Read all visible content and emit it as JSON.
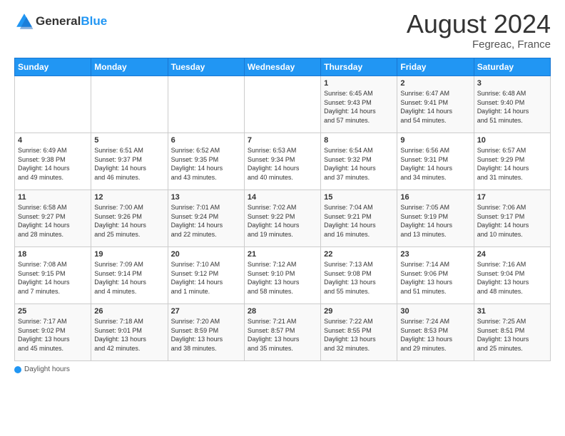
{
  "header": {
    "logo": {
      "general": "General",
      "blue": "Blue"
    },
    "month_year": "August 2024",
    "location": "Fegreac, France"
  },
  "days_of_week": [
    "Sunday",
    "Monday",
    "Tuesday",
    "Wednesday",
    "Thursday",
    "Friday",
    "Saturday"
  ],
  "weeks": [
    [
      {
        "day": "",
        "info": ""
      },
      {
        "day": "",
        "info": ""
      },
      {
        "day": "",
        "info": ""
      },
      {
        "day": "",
        "info": ""
      },
      {
        "day": "1",
        "info": "Sunrise: 6:45 AM\nSunset: 9:43 PM\nDaylight: 14 hours\nand 57 minutes."
      },
      {
        "day": "2",
        "info": "Sunrise: 6:47 AM\nSunset: 9:41 PM\nDaylight: 14 hours\nand 54 minutes."
      },
      {
        "day": "3",
        "info": "Sunrise: 6:48 AM\nSunset: 9:40 PM\nDaylight: 14 hours\nand 51 minutes."
      }
    ],
    [
      {
        "day": "4",
        "info": "Sunrise: 6:49 AM\nSunset: 9:38 PM\nDaylight: 14 hours\nand 49 minutes."
      },
      {
        "day": "5",
        "info": "Sunrise: 6:51 AM\nSunset: 9:37 PM\nDaylight: 14 hours\nand 46 minutes."
      },
      {
        "day": "6",
        "info": "Sunrise: 6:52 AM\nSunset: 9:35 PM\nDaylight: 14 hours\nand 43 minutes."
      },
      {
        "day": "7",
        "info": "Sunrise: 6:53 AM\nSunset: 9:34 PM\nDaylight: 14 hours\nand 40 minutes."
      },
      {
        "day": "8",
        "info": "Sunrise: 6:54 AM\nSunset: 9:32 PM\nDaylight: 14 hours\nand 37 minutes."
      },
      {
        "day": "9",
        "info": "Sunrise: 6:56 AM\nSunset: 9:31 PM\nDaylight: 14 hours\nand 34 minutes."
      },
      {
        "day": "10",
        "info": "Sunrise: 6:57 AM\nSunset: 9:29 PM\nDaylight: 14 hours\nand 31 minutes."
      }
    ],
    [
      {
        "day": "11",
        "info": "Sunrise: 6:58 AM\nSunset: 9:27 PM\nDaylight: 14 hours\nand 28 minutes."
      },
      {
        "day": "12",
        "info": "Sunrise: 7:00 AM\nSunset: 9:26 PM\nDaylight: 14 hours\nand 25 minutes."
      },
      {
        "day": "13",
        "info": "Sunrise: 7:01 AM\nSunset: 9:24 PM\nDaylight: 14 hours\nand 22 minutes."
      },
      {
        "day": "14",
        "info": "Sunrise: 7:02 AM\nSunset: 9:22 PM\nDaylight: 14 hours\nand 19 minutes."
      },
      {
        "day": "15",
        "info": "Sunrise: 7:04 AM\nSunset: 9:21 PM\nDaylight: 14 hours\nand 16 minutes."
      },
      {
        "day": "16",
        "info": "Sunrise: 7:05 AM\nSunset: 9:19 PM\nDaylight: 14 hours\nand 13 minutes."
      },
      {
        "day": "17",
        "info": "Sunrise: 7:06 AM\nSunset: 9:17 PM\nDaylight: 14 hours\nand 10 minutes."
      }
    ],
    [
      {
        "day": "18",
        "info": "Sunrise: 7:08 AM\nSunset: 9:15 PM\nDaylight: 14 hours\nand 7 minutes."
      },
      {
        "day": "19",
        "info": "Sunrise: 7:09 AM\nSunset: 9:14 PM\nDaylight: 14 hours\nand 4 minutes."
      },
      {
        "day": "20",
        "info": "Sunrise: 7:10 AM\nSunset: 9:12 PM\nDaylight: 14 hours\nand 1 minute."
      },
      {
        "day": "21",
        "info": "Sunrise: 7:12 AM\nSunset: 9:10 PM\nDaylight: 13 hours\nand 58 minutes."
      },
      {
        "day": "22",
        "info": "Sunrise: 7:13 AM\nSunset: 9:08 PM\nDaylight: 13 hours\nand 55 minutes."
      },
      {
        "day": "23",
        "info": "Sunrise: 7:14 AM\nSunset: 9:06 PM\nDaylight: 13 hours\nand 51 minutes."
      },
      {
        "day": "24",
        "info": "Sunrise: 7:16 AM\nSunset: 9:04 PM\nDaylight: 13 hours\nand 48 minutes."
      }
    ],
    [
      {
        "day": "25",
        "info": "Sunrise: 7:17 AM\nSunset: 9:02 PM\nDaylight: 13 hours\nand 45 minutes."
      },
      {
        "day": "26",
        "info": "Sunrise: 7:18 AM\nSunset: 9:01 PM\nDaylight: 13 hours\nand 42 minutes."
      },
      {
        "day": "27",
        "info": "Sunrise: 7:20 AM\nSunset: 8:59 PM\nDaylight: 13 hours\nand 38 minutes."
      },
      {
        "day": "28",
        "info": "Sunrise: 7:21 AM\nSunset: 8:57 PM\nDaylight: 13 hours\nand 35 minutes."
      },
      {
        "day": "29",
        "info": "Sunrise: 7:22 AM\nSunset: 8:55 PM\nDaylight: 13 hours\nand 32 minutes."
      },
      {
        "day": "30",
        "info": "Sunrise: 7:24 AM\nSunset: 8:53 PM\nDaylight: 13 hours\nand 29 minutes."
      },
      {
        "day": "31",
        "info": "Sunrise: 7:25 AM\nSunset: 8:51 PM\nDaylight: 13 hours\nand 25 minutes."
      }
    ]
  ],
  "footer": {
    "label": "Daylight hours"
  },
  "colors": {
    "header_bg": "#2196f3",
    "accent": "#2196f3"
  }
}
